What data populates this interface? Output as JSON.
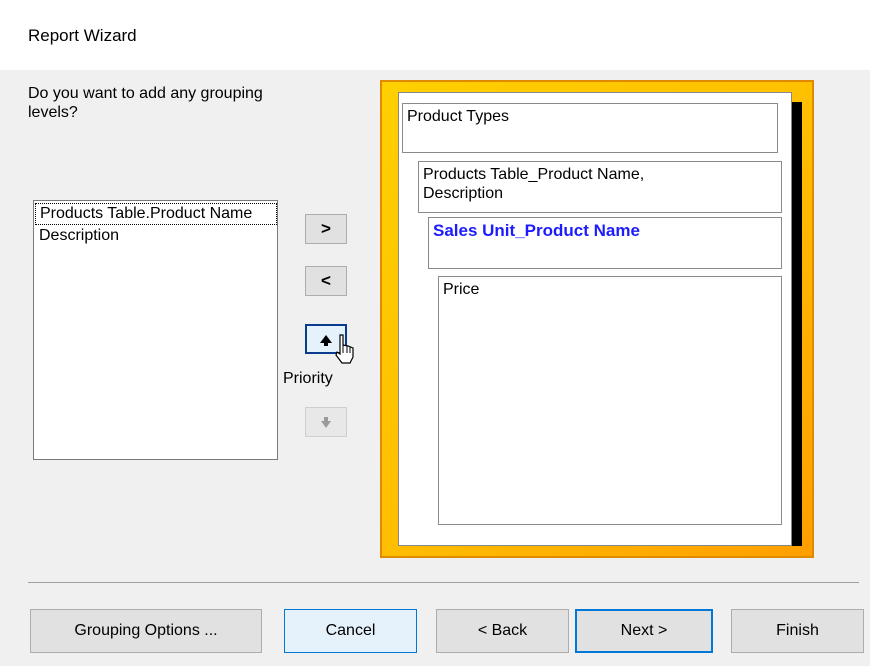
{
  "window": {
    "title": "Report Wizard"
  },
  "question": "Do you want to add any grouping\nlevels?",
  "fields": [
    {
      "label": "Products Table.Product Name",
      "selected": true
    },
    {
      "label": "Description",
      "selected": false
    }
  ],
  "move_buttons": {
    "add_label": ">",
    "remove_label": "<",
    "priority_label": "Priority"
  },
  "preview": {
    "level1": "Product Types",
    "level2": "Products Table_Product Name,\nDescription",
    "level3": "Sales Unit_Product Name",
    "detail": "Price"
  },
  "buttons": {
    "grouping_options": "Grouping Options ...",
    "cancel": "Cancel",
    "back": "< Back",
    "next": "Next >",
    "finish": "Finish"
  },
  "colors": {
    "accent": "#0078d7",
    "preview_highlight": "#1c1cff",
    "preview_frame": "#ffbf00"
  }
}
